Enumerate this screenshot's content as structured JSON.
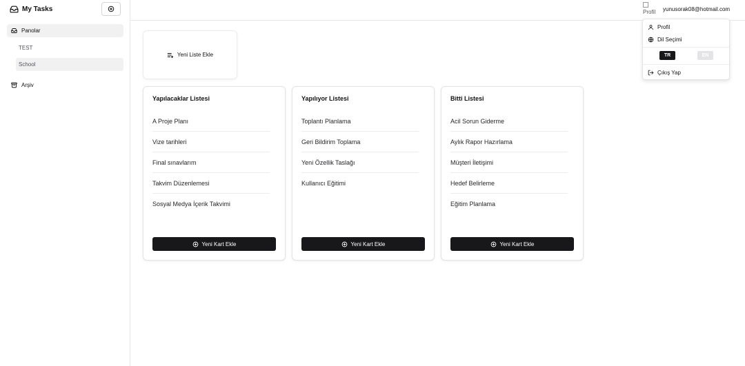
{
  "sidebar": {
    "brand": "My Tasks",
    "items": [
      {
        "label": "Panolar",
        "icon": "inbox-icon",
        "active": true
      },
      {
        "label": "Arşiv",
        "icon": "archive-icon",
        "active": false
      }
    ],
    "boards": [
      {
        "label": "TEST",
        "active": false
      },
      {
        "label": "School",
        "active": true
      }
    ]
  },
  "header": {
    "avatar_alt": "Profil",
    "email": "yunusorak08@hotmail.com"
  },
  "user_menu": {
    "profile": "Profil",
    "language": "Dil Seçimi",
    "lang_tr": "TR",
    "lang_en": "EN",
    "logout": "Çıkış Yap"
  },
  "main": {
    "new_list_label": "Yeni Liste Ekle",
    "lists": [
      {
        "title": "Yapılacaklar Listesi",
        "cards": [
          "A Proje Planı",
          "Vize tarihleri",
          "Final sınavlarım",
          "Takvim Düzenlemesi",
          "Sosyal Medya İçerik Takvimi"
        ],
        "add_label": "Yeni Kart Ekle"
      },
      {
        "title": "Yapılıyor Listesi",
        "cards": [
          "Toplantı Planlama",
          "Geri Bildirim Toplama",
          "Yeni Özellik Taslağı",
          "Kullanıcı Eğitimi"
        ],
        "add_label": "Yeni Kart Ekle"
      },
      {
        "title": "Bitti Listesi",
        "cards": [
          "Acil Sorun Giderme",
          "Aylık Rapor Hazırlama",
          "Müşteri İletişimi",
          "Hedef Belirleme",
          "Eğitim Planlama"
        ],
        "add_label": "Yeni Kart Ekle"
      }
    ]
  },
  "colors": {
    "primary": "#18181b",
    "border": "#e4e4e7",
    "active_bg": "#f1f1f2"
  }
}
